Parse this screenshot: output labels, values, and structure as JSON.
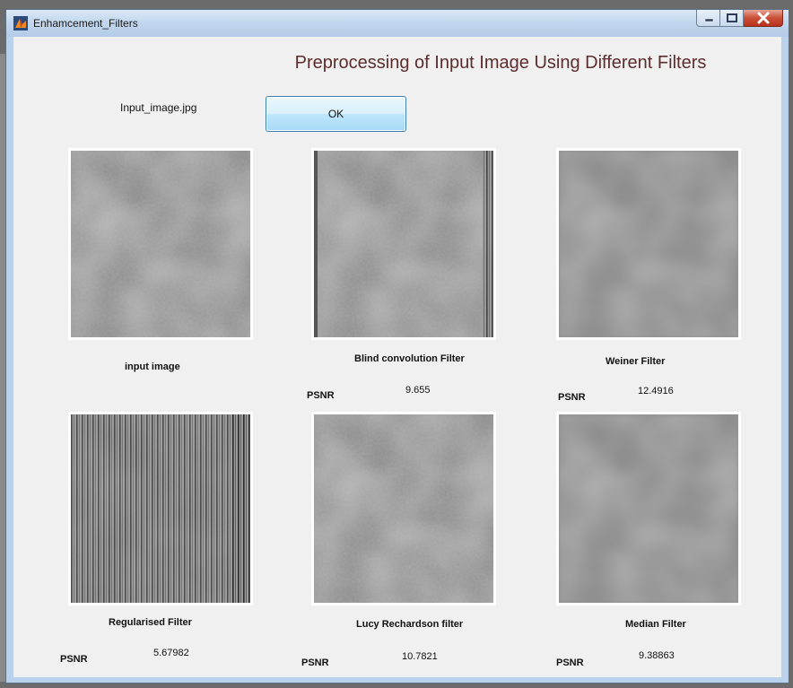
{
  "window": {
    "title": "Enhamcement_Filters"
  },
  "heading": "Preprocessing of Input Image Using Different Filters",
  "file_label": "Input_image.jpg",
  "ok_button": "OK",
  "psnr_label": "PSNR",
  "panels": [
    {
      "caption": "input image"
    },
    {
      "caption": "Blind convolution  Filter",
      "psnr": "9.655"
    },
    {
      "caption": "Weiner Filter",
      "psnr": "12.4916"
    },
    {
      "caption": "Regularised Filter",
      "psnr": "5.67982"
    },
    {
      "caption": "Lucy Rechardson filter",
      "psnr": "10.7821"
    },
    {
      "caption": "Median Filter",
      "psnr": "9.38863"
    }
  ]
}
